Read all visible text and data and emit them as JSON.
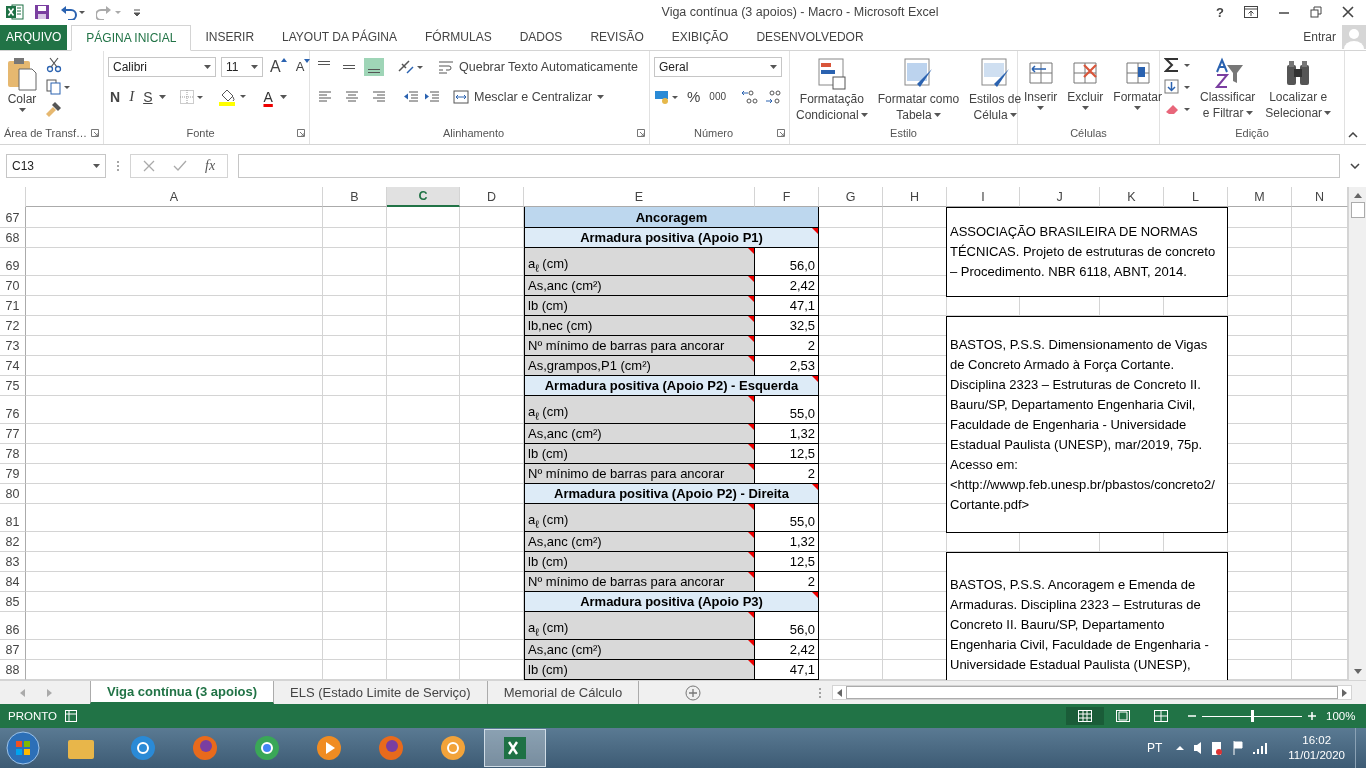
{
  "window": {
    "title": "Viga contínua (3 apoios) - Macro - Microsoft Excel",
    "help": "?"
  },
  "menu_tabs": [
    {
      "label": "ARQUIVO",
      "kind": "file",
      "selected": false
    },
    {
      "label": "PÁGINA INICIAL",
      "kind": "tab",
      "selected": true
    },
    {
      "label": "INSERIR",
      "kind": "tab",
      "selected": false
    },
    {
      "label": "LAYOUT DA PÁGINA",
      "kind": "tab",
      "selected": false
    },
    {
      "label": "FÓRMULAS",
      "kind": "tab",
      "selected": false
    },
    {
      "label": "DADOS",
      "kind": "tab",
      "selected": false
    },
    {
      "label": "REVISÃO",
      "kind": "tab",
      "selected": false
    },
    {
      "label": "EXIBIÇÃO",
      "kind": "tab",
      "selected": false
    },
    {
      "label": "DESENVOLVEDOR",
      "kind": "tab",
      "selected": false
    }
  ],
  "account": "Entrar",
  "clipboard": {
    "paste": "Colar",
    "group": "Área de Transf…"
  },
  "font": {
    "name": "Calibri",
    "size": "11",
    "grow": "A",
    "shrink": "A",
    "bold": "N",
    "italic": "I",
    "underline": "S",
    "font_color": "A",
    "group": "Fonte"
  },
  "alignment": {
    "vertical": [
      {
        "selected": false
      },
      {
        "selected": false
      },
      {
        "selected": true
      }
    ],
    "wrap": "Quebrar Texto Automaticamente",
    "merge": "Mesclar e Centralizar",
    "group": "Alinhamento"
  },
  "number": {
    "format": "Geral",
    "percent": "%",
    "thousands": "000",
    "group": "Número"
  },
  "styles": {
    "buttons": [
      {
        "lines": [
          "Formatação",
          "Condicional"
        ]
      },
      {
        "lines": [
          "Formatar como",
          "Tabela"
        ]
      },
      {
        "lines": [
          "Estilos de",
          "Célula"
        ]
      }
    ],
    "group": "Estilo"
  },
  "cells": {
    "buttons": [
      {
        "lines": [
          "Inserir"
        ]
      },
      {
        "lines": [
          "Excluir"
        ]
      },
      {
        "lines": [
          "Formatar"
        ]
      }
    ],
    "group": "Células"
  },
  "editing": {
    "buttons": [
      {
        "lines": [
          "Classificar",
          "e Filtrar"
        ]
      },
      {
        "lines": [
          "Localizar e",
          "Selecionar"
        ]
      }
    ],
    "group": "Edição"
  },
  "formula_bar": {
    "name_box": "C13",
    "fx": "fx"
  },
  "columns": [
    {
      "label": "A",
      "selected": false
    },
    {
      "label": "B",
      "selected": false
    },
    {
      "label": "C",
      "selected": true
    },
    {
      "label": "D",
      "selected": false
    },
    {
      "label": "E",
      "selected": false
    },
    {
      "label": "F",
      "selected": false
    },
    {
      "label": "G",
      "selected": false
    },
    {
      "label": "H",
      "selected": false
    },
    {
      "label": "I",
      "selected": false
    },
    {
      "label": "J",
      "selected": false
    },
    {
      "label": "K",
      "selected": false
    },
    {
      "label": "L",
      "selected": false
    },
    {
      "label": "M",
      "selected": false
    },
    {
      "label": "N",
      "selected": false
    }
  ],
  "row_numbers": [
    "67",
    "68",
    "69",
    "70",
    "71",
    "72",
    "73",
    "74",
    "75",
    "76",
    "77",
    "78",
    "79",
    "80",
    "81",
    "82",
    "83",
    "84",
    "85",
    "86",
    "87",
    "88"
  ],
  "anchorage": {
    "title": "Ancoragem",
    "sections": [
      {
        "title": "Armadura positiva (Apoio P1)",
        "comment": true,
        "items": [
          {
            "label": "a$_{ℓ}$ (cm)",
            "value": "56,0",
            "comment": true
          },
          {
            "label": "As,anc (cm²)",
            "value": "2,42",
            "comment": true
          },
          {
            "label": "lb (cm)",
            "value": "47,1",
            "comment": true
          },
          {
            "label": "lb,nec (cm)",
            "value": "32,5",
            "comment": true
          },
          {
            "label": "Nº mínimo de barras para ancorar",
            "value": "2",
            "comment": true
          },
          {
            "label": "As,grampos,P1 (cm²)",
            "value": "2,53",
            "comment": true
          }
        ]
      },
      {
        "title": "Armadura positiva (Apoio P2) - Esquerda",
        "comment": true,
        "items": [
          {
            "label": "a$_{ℓ}$ (cm)",
            "value": "55,0",
            "comment": true
          },
          {
            "label": "As,anc (cm²)",
            "value": "1,32",
            "comment": true
          },
          {
            "label": "lb (cm)",
            "value": "12,5",
            "comment": true
          },
          {
            "label": "Nº mínimo de barras para ancorar",
            "value": "2",
            "comment": true
          }
        ]
      },
      {
        "title": "Armadura positiva (Apoio P2) - Direita",
        "comment": true,
        "items": [
          {
            "label": "a$_{ℓ}$ (cm)",
            "value": "55,0",
            "comment": true
          },
          {
            "label": "As,anc (cm²)",
            "value": "1,32",
            "comment": true
          },
          {
            "label": "lb (cm)",
            "value": "12,5",
            "comment": true
          },
          {
            "label": "Nº mínimo de barras para ancorar",
            "value": "2",
            "comment": true
          }
        ]
      },
      {
        "title": "Armadura positiva (Apoio P3)",
        "comment": true,
        "items": [
          {
            "label": "a$_{ℓ}$ (cm)",
            "value": "56,0",
            "comment": true
          },
          {
            "label": "As,anc (cm²)",
            "value": "2,42",
            "comment": true
          },
          {
            "label": "lb (cm)",
            "value": "47,1",
            "comment": true
          }
        ]
      }
    ]
  },
  "references": [
    "ASSOCIAÇÃO BRASILEIRA DE NORMAS TÉCNICAS. Projeto de estruturas de concreto – Procedimento. NBR 6118, ABNT, 2014.",
    "BASTOS, P.S.S. Dimensionamento de Vigas de Concreto Armado à Força Cortante. Disciplina 2323 – Estruturas de Concreto II. Bauru/SP, Departamento Engenharia Civil, Faculdade de Engenharia - Universidade Estadual Paulista (UNESP), mar/2019, 75p. Acesso em: <http://wwwp.feb.unesp.br/pbastos/concreto2/Cortante.pdf>",
    "BASTOS, P.S.S. Ancoragem e Emenda de Armaduras. Disciplina 2323 – Estruturas de Concreto II. Bauru/SP, Departamento Engenharia Civil, Faculdade de Engenharia - Universidade Estadual Paulista (UNESP),"
  ],
  "sheet_tabs": [
    {
      "label": "Viga contínua (3 apoios)",
      "selected": true
    },
    {
      "label": "ELS (Estado Limite de Serviço)",
      "selected": false
    },
    {
      "label": "Memorial de Cálculo",
      "selected": false
    }
  ],
  "status_bar": {
    "status": "PRONTO",
    "views": [
      {
        "selected": true
      },
      {
        "selected": false
      },
      {
        "selected": false
      }
    ],
    "zoom_slider": {
      "level": 0.5
    },
    "zoom": "100%"
  },
  "taskbar": {
    "apps": [
      {
        "kind": "folder",
        "selected": false
      },
      {
        "kind": "ie",
        "selected": false
      },
      {
        "kind": "firefox",
        "selected": false
      },
      {
        "kind": "chrome",
        "selected": false
      },
      {
        "kind": "media",
        "selected": false
      },
      {
        "kind": "firefox",
        "selected": false
      },
      {
        "kind": "helm",
        "selected": false
      },
      {
        "kind": "excel",
        "selected": true
      }
    ],
    "language": "PT",
    "time": "16:02",
    "date": "11/01/2020"
  }
}
